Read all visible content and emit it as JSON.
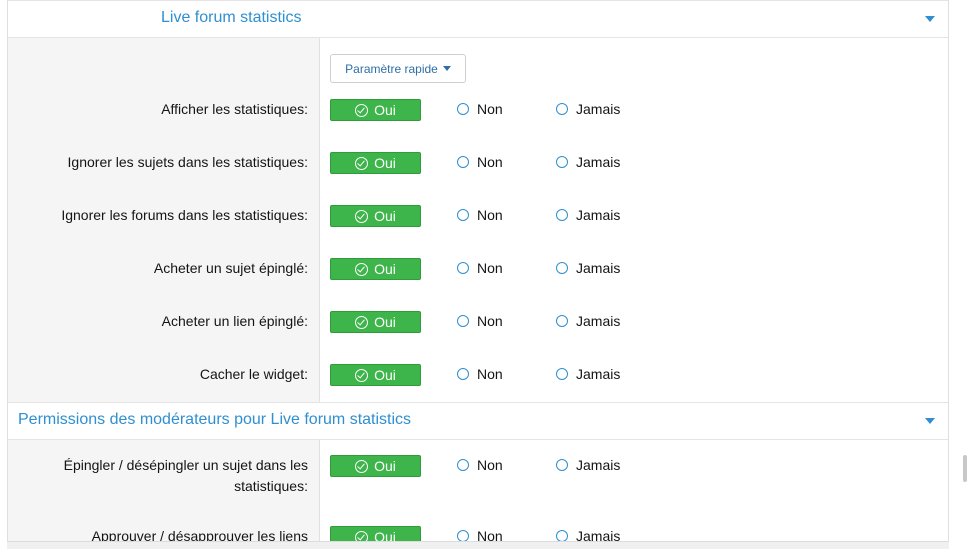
{
  "sections": [
    {
      "title": "Live forum statistics",
      "quick_settings_label": "Paramètre rapide",
      "rows": [
        {
          "label": "Afficher les statistiques:",
          "oui": "Oui",
          "non": "Non",
          "jamais": "Jamais"
        },
        {
          "label": "Ignorer les sujets dans les statistiques:",
          "oui": "Oui",
          "non": "Non",
          "jamais": "Jamais"
        },
        {
          "label": "Ignorer les forums dans les statistiques:",
          "oui": "Oui",
          "non": "Non",
          "jamais": "Jamais"
        },
        {
          "label": "Acheter un sujet épinglé:",
          "oui": "Oui",
          "non": "Non",
          "jamais": "Jamais"
        },
        {
          "label": "Acheter un lien épinglé:",
          "oui": "Oui",
          "non": "Non",
          "jamais": "Jamais"
        },
        {
          "label": "Cacher le widget:",
          "oui": "Oui",
          "non": "Non",
          "jamais": "Jamais"
        }
      ]
    },
    {
      "title": "Permissions des modérateurs pour Live forum statistics",
      "rows": [
        {
          "label_line1": "Épingler / désépingler un sujet dans les",
          "label_line2": "statistiques:",
          "oui": "Oui",
          "non": "Non",
          "jamais": "Jamais"
        },
        {
          "label": "Approuver / désapprouver les liens",
          "oui": "Oui",
          "non": "Non",
          "jamais": "Jamais"
        }
      ]
    }
  ],
  "colors": {
    "accent": "#2f8fd0",
    "oui_green": "#3eb54b"
  },
  "icons": {
    "collapse": "caret-down-icon",
    "selected": "check-circle-icon"
  }
}
